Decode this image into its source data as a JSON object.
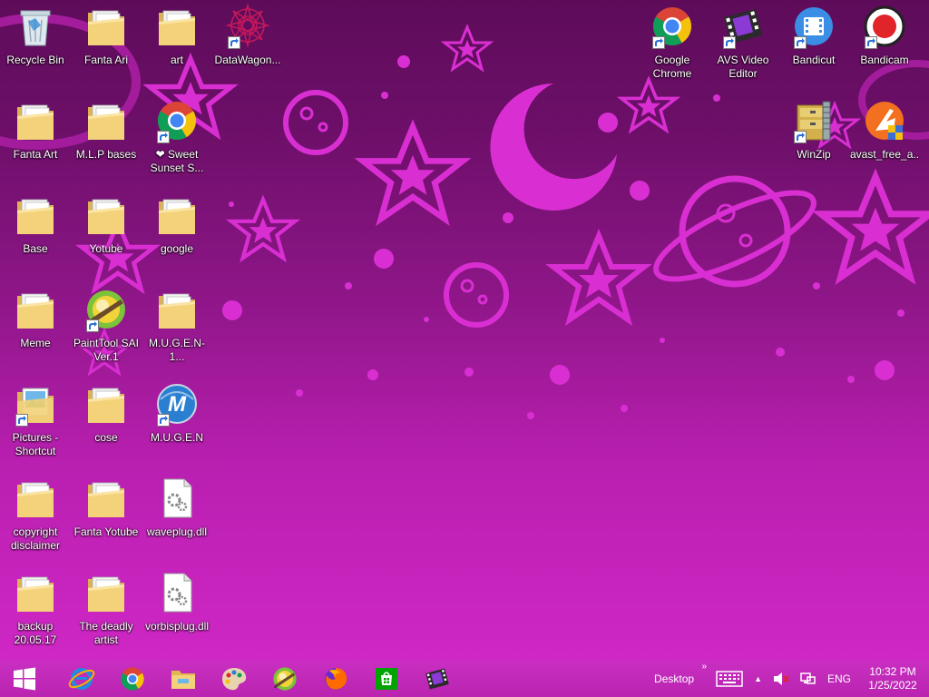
{
  "colors": {
    "wallpaper_top": "#5e0c5a",
    "wallpaper_bottom": "#cf27c5",
    "shape": "#d92fd2",
    "taskbar": "#c02ab8"
  },
  "desktop_icons": [
    {
      "label": "Recycle Bin",
      "icon": "recycle-bin-icon"
    },
    {
      "label": "Fanta Ari",
      "icon": "folder-icon"
    },
    {
      "label": "art",
      "icon": "folder-icon"
    },
    {
      "label": "DataWagon...",
      "icon": "datawagon-icon"
    },
    {
      "label": "Fanta Art",
      "icon": "folder-icon"
    },
    {
      "label": "M.L.P bases",
      "icon": "folder-icon"
    },
    {
      "label": "❤ Sweet Sunset S...",
      "icon": "chrome-icon"
    },
    {
      "label": "Base",
      "icon": "folder-icon"
    },
    {
      "label": "Yotube",
      "icon": "folder-icon"
    },
    {
      "label": "google",
      "icon": "folder-icon"
    },
    {
      "label": "Meme",
      "icon": "folder-icon"
    },
    {
      "label": "PaintTool SAI Ver.1",
      "icon": "painttool-sai-icon"
    },
    {
      "label": "M.U.G.E.N-1...",
      "icon": "folder-icon"
    },
    {
      "label": "Pictures - Shortcut",
      "icon": "pictures-icon"
    },
    {
      "label": "cose",
      "icon": "folder-icon"
    },
    {
      "label": "M.U.G.E.N",
      "icon": "mugen-icon"
    },
    {
      "label": "copyright disclaimer",
      "icon": "folder-icon"
    },
    {
      "label": "Fanta Yotube",
      "icon": "folder-icon"
    },
    {
      "label": "waveplug.dll",
      "icon": "dll-file-icon"
    },
    {
      "label": "backup 20.05.17",
      "icon": "folder-icon"
    },
    {
      "label": "The deadly artist",
      "icon": "folder-icon"
    },
    {
      "label": "vorbisplug.dll",
      "icon": "dll-file-icon"
    },
    {
      "label": "Google Chrome",
      "icon": "chrome-icon"
    },
    {
      "label": "AVS Video Editor",
      "icon": "avs-video-editor-icon"
    },
    {
      "label": "Bandicut",
      "icon": "bandicut-icon"
    },
    {
      "label": "Bandicam",
      "icon": "bandicam-icon"
    },
    {
      "label": "WinZip",
      "icon": "winzip-icon"
    },
    {
      "label": "avast_free_a...",
      "icon": "avast-installer-icon"
    }
  ],
  "taskbar": {
    "pinned": [
      {
        "name": "internet-explorer-icon"
      },
      {
        "name": "chrome-icon"
      },
      {
        "name": "file-explorer-icon"
      },
      {
        "name": "paint-palette-icon"
      },
      {
        "name": "painttool-sai-icon"
      },
      {
        "name": "firefox-icon"
      },
      {
        "name": "windows-store-icon"
      },
      {
        "name": "avs-video-editor-icon"
      }
    ],
    "desktop_label": "Desktop",
    "language": "ENG",
    "time": "10:32 PM",
    "date": "1/25/2022"
  }
}
